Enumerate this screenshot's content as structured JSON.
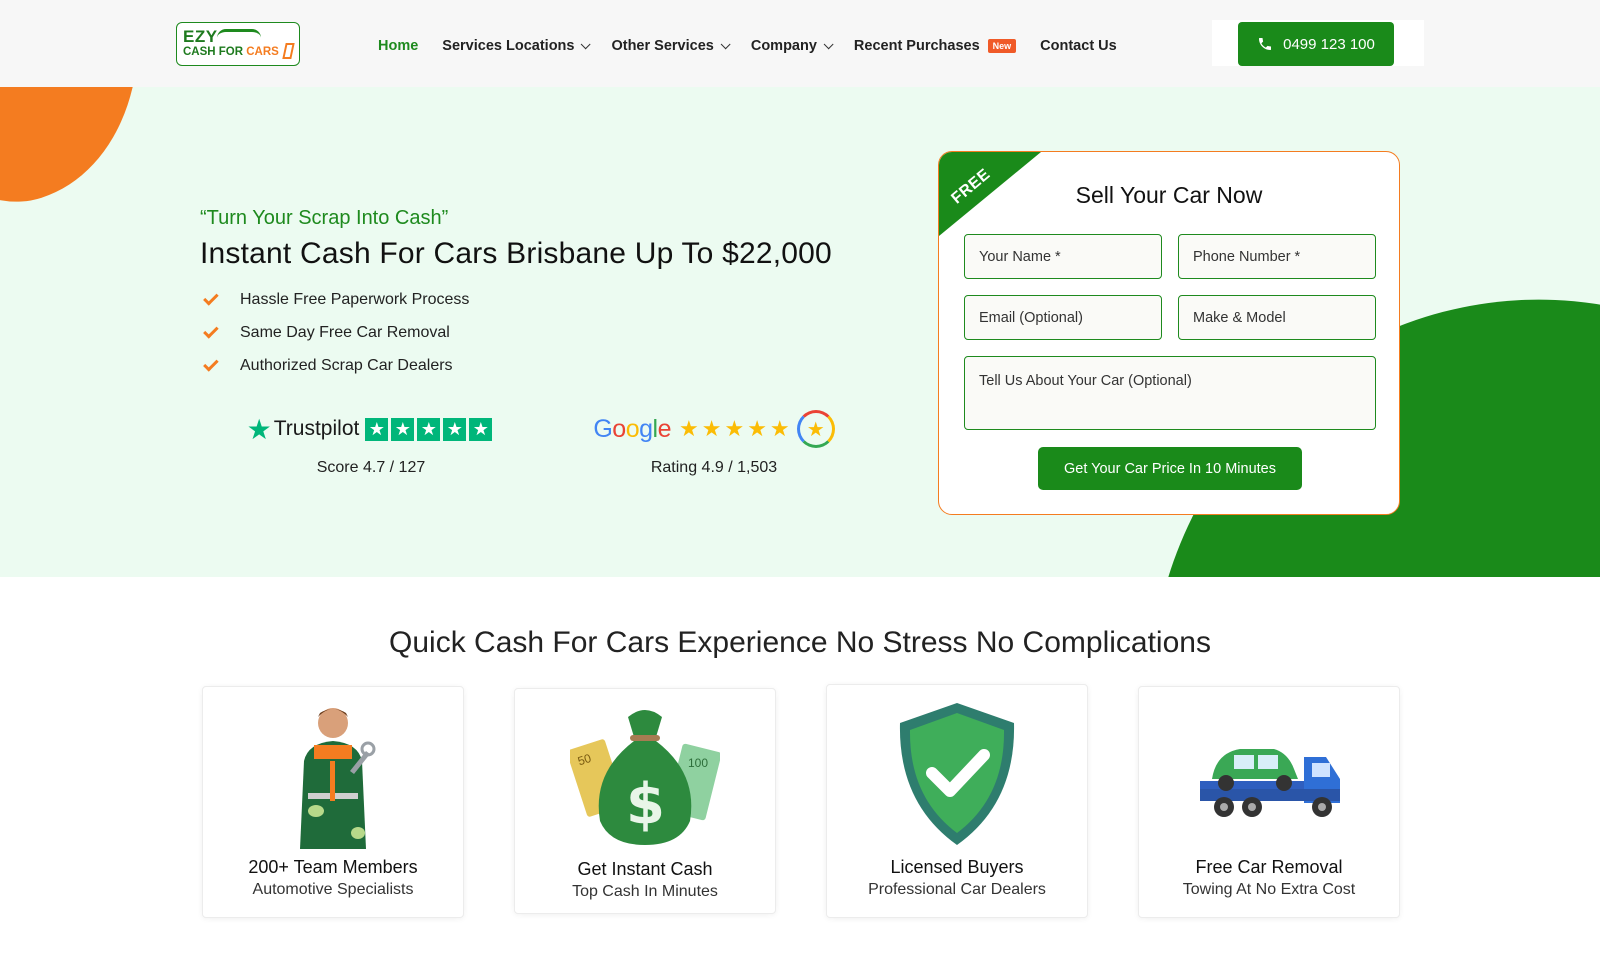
{
  "header": {
    "logo": {
      "line1": "EZY",
      "line2a": "CASH FOR ",
      "line2b": "CARS"
    },
    "nav": [
      {
        "label": "Home",
        "active": true,
        "dropdown": false
      },
      {
        "label": "Services Locations",
        "dropdown": true
      },
      {
        "label": "Other Services",
        "dropdown": true
      },
      {
        "label": "Company",
        "dropdown": true
      },
      {
        "label": "Recent Purchases",
        "badge": "New",
        "dropdown": false
      },
      {
        "label": "Contact Us",
        "dropdown": false
      }
    ],
    "phone": "0499 123 100"
  },
  "hero": {
    "tagline": "“Turn Your Scrap Into Cash”",
    "title": "Instant Cash For Cars Brisbane Up To $22,000",
    "features": [
      "Hassle Free Paperwork Process",
      "Same Day Free Car Removal",
      "Authorized Scrap Car Dealers"
    ],
    "trustpilot": {
      "brand": "Trustpilot",
      "score": "Score 4.7 / 127"
    },
    "google": {
      "brand": "Google",
      "score": "Rating 4.9 / 1,503"
    }
  },
  "form": {
    "ribbon": "FREE",
    "title": "Sell Your Car Now",
    "name_placeholder": "Your Name *",
    "phone_placeholder": "Phone Number *",
    "email_placeholder": "Email (Optional)",
    "make_placeholder": "Make & Model",
    "about_placeholder": "Tell Us About Your Car (Optional)",
    "submit": "Get Your Car Price In 10 Minutes"
  },
  "section": {
    "title": "Quick Cash For Cars Experience No Stress No Complications",
    "cards": [
      {
        "title": "200+ Team Members",
        "subtitle": "Automotive Specialists",
        "icon": "mechanic-icon"
      },
      {
        "title": "Get Instant Cash",
        "subtitle": "Top Cash In Minutes",
        "icon": "money-bag-icon"
      },
      {
        "title": "Licensed Buyers",
        "subtitle": "Professional Car Dealers",
        "icon": "shield-check-icon"
      },
      {
        "title": "Free Car Removal",
        "subtitle": "Towing At No Extra Cost",
        "icon": "tow-truck-icon"
      }
    ]
  },
  "colors": {
    "brand_green": "#1a8a1a",
    "accent_orange": "#f47c20",
    "hero_bg": "#ecfbf1"
  }
}
